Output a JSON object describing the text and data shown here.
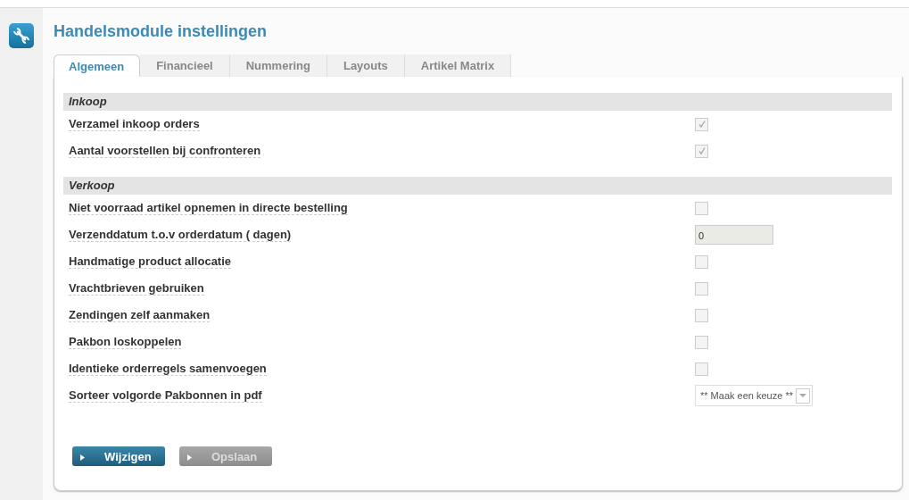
{
  "page": {
    "title": "Handelsmodule instellingen"
  },
  "tabs": [
    {
      "label": "Algemeen",
      "selected": true
    },
    {
      "label": "Financieel",
      "selected": false
    },
    {
      "label": "Nummering",
      "selected": false
    },
    {
      "label": "Layouts",
      "selected": false
    },
    {
      "label": "Artikel Matrix",
      "selected": false
    }
  ],
  "sections": [
    {
      "title": "Inkoop",
      "rows": [
        {
          "kind": "checkbox",
          "label": "Verzamel inkoop orders",
          "checked": true
        },
        {
          "kind": "checkbox",
          "label": "Aantal voorstellen bij confronteren",
          "checked": true
        }
      ]
    },
    {
      "title": "Verkoop",
      "rows": [
        {
          "kind": "checkbox",
          "label": "Niet voorraad artikel opnemen in directe bestelling",
          "checked": false
        },
        {
          "kind": "number",
          "label": "Verzenddatum t.o.v orderdatum ( dagen)",
          "value": "0"
        },
        {
          "kind": "checkbox",
          "label": "Handmatige product allocatie",
          "checked": false
        },
        {
          "kind": "checkbox",
          "label": "Vrachtbrieven gebruiken",
          "checked": false
        },
        {
          "kind": "checkbox",
          "label": "Zendingen zelf aanmaken",
          "checked": false
        },
        {
          "kind": "checkbox",
          "label": "Pakbon loskoppelen",
          "checked": false
        },
        {
          "kind": "checkbox",
          "label": "Identieke orderregels samenvoegen",
          "checked": false
        },
        {
          "kind": "select",
          "label": "Sorteer volgorde Pakbonnen in pdf",
          "value": "** Maak een keuze **"
        }
      ]
    }
  ],
  "buttons": [
    {
      "label": "Wijzigen",
      "disabled": false
    },
    {
      "label": "Opslaan",
      "disabled": true
    }
  ]
}
